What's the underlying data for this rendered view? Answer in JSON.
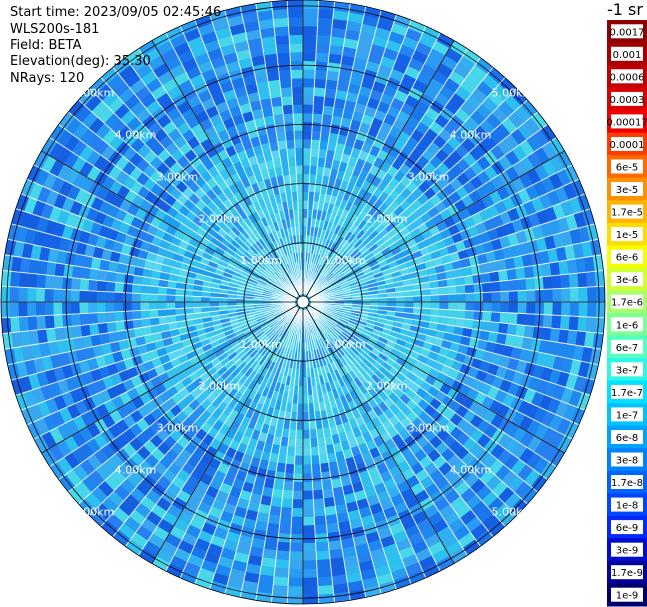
{
  "header": {
    "start_time": "Start time: 2023/09/05 02:45:46",
    "instrument": "WLS200s-181",
    "field": "Field: BETA",
    "elevation": "Elevation(deg): 35.30",
    "nrays": "NRays: 120"
  },
  "colorbar": {
    "unit_label": "-1 sr",
    "labels": [
      "0.0017",
      "0.001",
      "0.0006",
      "0.0003",
      "0.00017",
      "0.0001",
      "6e-5",
      "3e-5",
      "1.7e-5",
      "1e-5",
      "6e-6",
      "3e-6",
      "1.7e-6",
      "1e-6",
      "6e-7",
      "3e-7",
      "1.7e-7",
      "1e-7",
      "6e-8",
      "3e-8",
      "1.7e-8",
      "1e-8",
      "6e-9",
      "3e-9",
      "1.7e-9",
      "1e-9"
    ],
    "colors": [
      "#8b0000",
      "#a50000",
      "#c00000",
      "#d80000",
      "#ee0000",
      "#ff3c00",
      "#ff6a00",
      "#ff9000",
      "#ffb400",
      "#ffdc00",
      "#f5ff00",
      "#d2ff30",
      "#a8ff6a",
      "#7eff96",
      "#54ffbf",
      "#2ef7e8",
      "#00e0ff",
      "#00c2ff",
      "#00a2ff",
      "#0082ff",
      "#0064ff",
      "#0046ff",
      "#0028ff",
      "#000ecc",
      "#00009a",
      "#00006a"
    ]
  },
  "chart_data": {
    "type": "heatmap",
    "projection": "polar (PPI)",
    "range_ring_labels": [
      "1.00km",
      "2.00km",
      "3.00km",
      "4.00km",
      "5.00km"
    ],
    "range_rings_km": [
      1,
      2,
      3,
      4,
      5
    ],
    "max_range_km": 5.1,
    "spokes_deg": [
      0,
      30,
      60,
      90,
      120,
      150,
      180,
      210,
      240,
      270,
      300,
      330
    ],
    "n_rays": 120,
    "dominant_value_range": [
      "1e-8",
      "1e-7"
    ]
  }
}
